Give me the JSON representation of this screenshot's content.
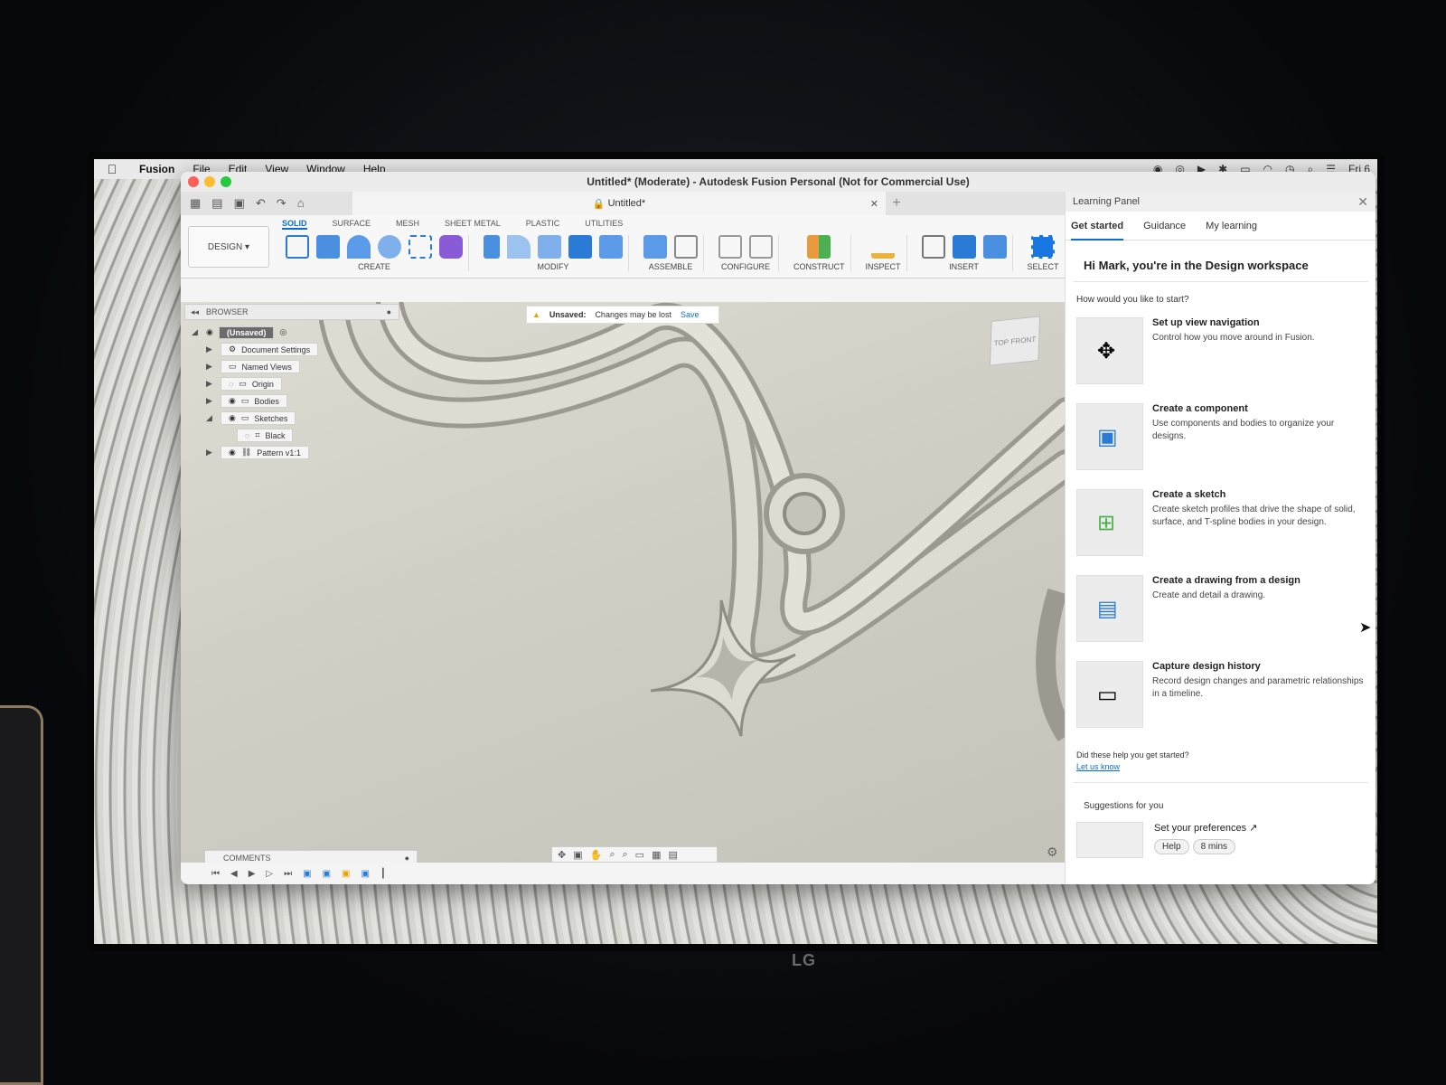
{
  "menubar": {
    "app": "Fusion",
    "items": [
      "File",
      "Edit",
      "View",
      "Window",
      "Help"
    ],
    "clock": "Fri 6"
  },
  "window": {
    "title": "Untitled* (Moderate) - Autodesk Fusion Personal (Not for Commercial Use)",
    "doc_tab": "Untitled*"
  },
  "toolbar": {
    "workspace": "DESIGN",
    "tabs": [
      "SOLID",
      "SURFACE",
      "MESH",
      "SHEET METAL",
      "PLASTIC",
      "UTILITIES"
    ],
    "groups": [
      "CREATE",
      "MODIFY",
      "ASSEMBLE",
      "CONFIGURE",
      "CONSTRUCT",
      "INSPECT",
      "INSERT",
      "SELECT"
    ]
  },
  "unsaved_bar": {
    "label": "Unsaved:",
    "message": "Changes may be lost",
    "save": "Save"
  },
  "browser": {
    "title": "BROWSER",
    "root": "(Unsaved)",
    "items": [
      "Document Settings",
      "Named Views",
      "Origin",
      "Bodies",
      "Sketches",
      "Black",
      "Pattern v1:1"
    ]
  },
  "viewcube": {
    "top": "TOP",
    "front": "FRONT"
  },
  "comments": {
    "label": "COMMENTS"
  },
  "learning_panel": {
    "title": "Learning Panel",
    "tabs": [
      "Get started",
      "Guidance",
      "My learning"
    ],
    "greeting": "Hi Mark, you're in the Design workspace",
    "prompt": "How would you like to start?",
    "cards": [
      {
        "title": "Set up view navigation",
        "desc": "Control how you move around in Fusion."
      },
      {
        "title": "Create a component",
        "desc": "Use components and bodies to organize your designs."
      },
      {
        "title": "Create a sketch",
        "desc": "Create sketch profiles that drive the shape of solid, surface, and T-spline bodies in your design."
      },
      {
        "title": "Create a drawing from a design",
        "desc": "Create and detail a drawing."
      },
      {
        "title": "Capture design history",
        "desc": "Record design changes and parametric relationships in a timeline."
      }
    ],
    "feedback_q": "Did these help you get started?",
    "feedback_link": "Let us know",
    "suggestions_title": "Suggestions for you",
    "suggestion": {
      "title": "Set your preferences",
      "chip1": "Help",
      "chip2": "8 mins"
    }
  },
  "monitor_brand": "LG",
  "colors": {
    "accent": "#0a6ed1",
    "close": "#ff5f57",
    "minimize": "#febc2e",
    "maximize": "#28c840"
  }
}
